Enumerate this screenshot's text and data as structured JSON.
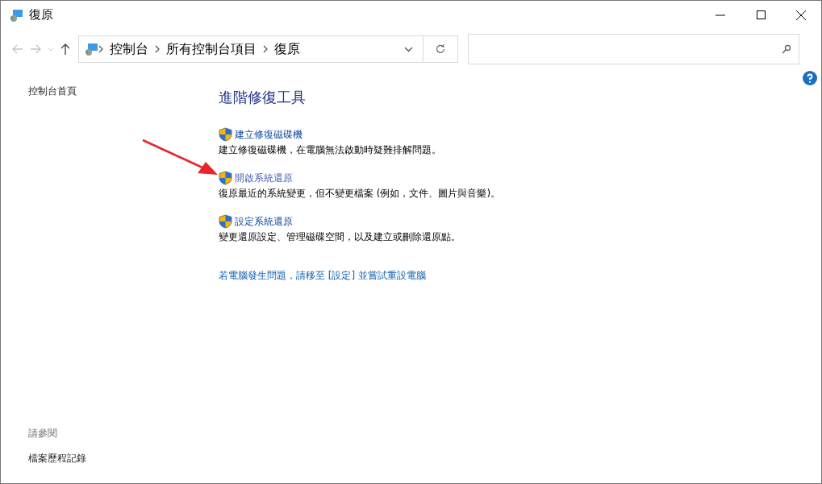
{
  "window": {
    "title": "復原"
  },
  "breadcrumb": [
    "控制台",
    "所有控制台項目",
    "復原"
  ],
  "sidebar": {
    "home_link": "控制台首頁",
    "see_also_heading": "請參閱",
    "see_also_links": [
      "檔案歷程記錄"
    ]
  },
  "content": {
    "heading": "進階修復工具",
    "tools": [
      {
        "title": "建立修復磁碟機",
        "description": "建立修復磁碟機，在電腦無法啟動時疑難排解問題。",
        "highlighted": false
      },
      {
        "title": "開啟系統還原",
        "description": "復原最近的系統變更，但不變更檔案 (例如，文件、圖片與音樂)。",
        "highlighted": true
      },
      {
        "title": "設定系統還原",
        "description": "變更還原設定、管理磁碟空間，以及建立或刪除還原點。",
        "highlighted": false
      }
    ],
    "reset_link": "若電腦發生問題，請移至 [設定] 並嘗試重設電腦"
  }
}
